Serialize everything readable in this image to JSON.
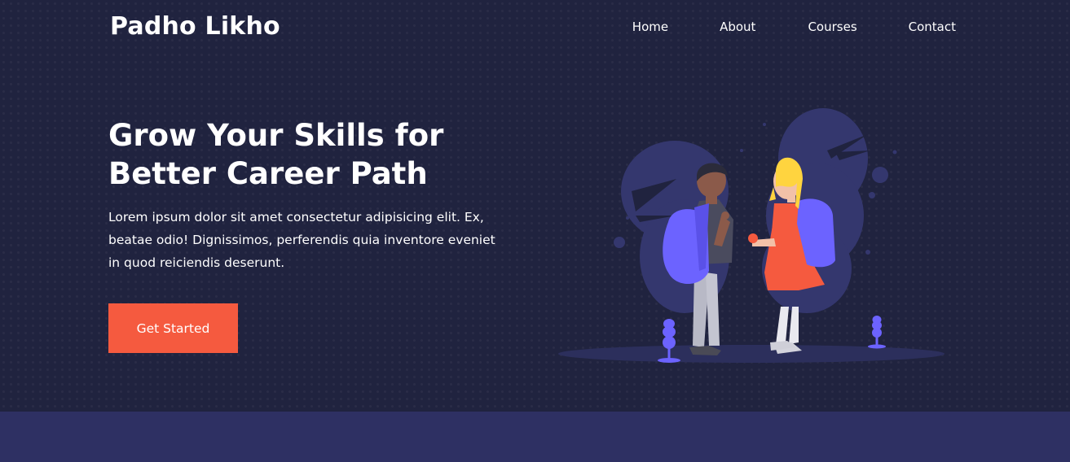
{
  "header": {
    "brand": "Padho Likho",
    "nav": [
      {
        "label": "Home"
      },
      {
        "label": "About"
      },
      {
        "label": "Courses"
      },
      {
        "label": "Contact"
      }
    ]
  },
  "hero": {
    "headline_line1": "Grow Your Skills for",
    "headline_line2": "Better Career Path",
    "description": "Lorem ipsum dolor sit amet consectetur adipisicing elit. Ex, beatae odio! Dignissimos, perferendis quia inventore eveniet in quod reiciendis deserunt.",
    "cta_label": "Get Started",
    "illustration": "students-with-backpacks-illustration"
  },
  "colors": {
    "background": "#20233f",
    "accent": "#f55a3f",
    "band": "#2e3063",
    "illustration_primary": "#6c63ff"
  }
}
